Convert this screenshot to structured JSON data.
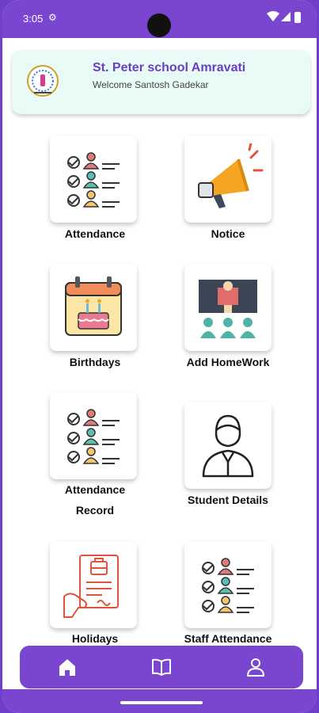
{
  "status_bar": {
    "time": "3:05",
    "gear_icon": "gear-icon"
  },
  "header": {
    "school_name": "St. Peter school Amravati",
    "welcome": "Welcome Santosh Gadekar",
    "logo_icon": "school-logo"
  },
  "tiles": [
    {
      "label": "Attendance",
      "icon": "attendance-icon"
    },
    {
      "label": "Notice",
      "icon": "megaphone-icon"
    },
    {
      "label": "Birthdays",
      "icon": "birthday-calendar-icon"
    },
    {
      "label": "Add HomeWork",
      "icon": "classroom-icon"
    },
    {
      "label": "Attendance",
      "label2": "Record",
      "icon": "attendance-record-icon"
    },
    {
      "label": "Student Details",
      "icon": "student-icon"
    },
    {
      "label": "Holidays",
      "icon": "holiday-document-icon"
    },
    {
      "label": "Staff Attendance",
      "icon": "staff-attendance-icon"
    }
  ],
  "bottom_nav": [
    {
      "icon": "home-icon"
    },
    {
      "icon": "book-icon"
    },
    {
      "icon": "profile-icon"
    }
  ],
  "colors": {
    "primary": "#7a46d0",
    "header_bg": "#e9fbf7",
    "title": "#6a3fc2"
  }
}
